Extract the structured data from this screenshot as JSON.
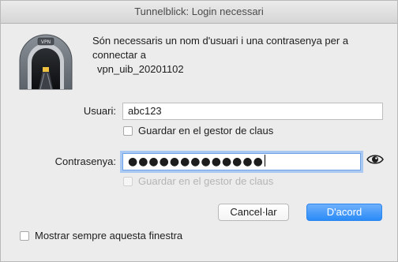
{
  "window": {
    "title": "Tunnelblick: Login necessari"
  },
  "logo": {
    "badge_text": "VPN"
  },
  "message": {
    "line1": "Són necessaris un nom d'usuari i una contrasenya per a",
    "line2": "connectar a",
    "connection_name": "vpn_uib_20201102"
  },
  "username": {
    "label": "Usuari:",
    "value": "abc123",
    "save_label": "Guardar en el gestor de claus",
    "save_checked": false
  },
  "password": {
    "label": "Contrasenya:",
    "masked_value": "●●●●●●●●●●●●●",
    "save_label": "Guardar en el gestor de claus",
    "save_checked": false,
    "save_enabled": false,
    "reveal_icon": "eye-icon"
  },
  "buttons": {
    "cancel_label": "Cancel·lar",
    "ok_label": "D'acord"
  },
  "footer": {
    "always_show_label": "Mostrar sempre aquesta finestra",
    "always_show_checked": false
  },
  "colors": {
    "primary_button": "#2a8bf7",
    "focus_ring": "#a9c9f2",
    "window_background": "#ececec"
  }
}
